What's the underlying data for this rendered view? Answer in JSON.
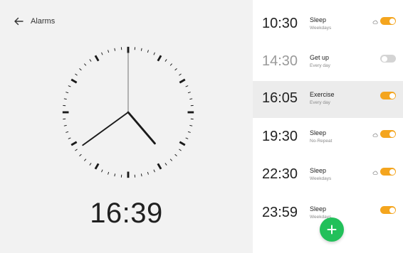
{
  "header": {
    "title": "Alarms",
    "back_icon": "arrow-left-icon"
  },
  "clock": {
    "hour": 16,
    "minute": 39,
    "digital_time": "16:39"
  },
  "alarms": [
    {
      "time": "10:30",
      "label": "Sleep",
      "repeat": "Weekdays",
      "enabled": true,
      "cloud_icon": true,
      "selected": false
    },
    {
      "time": "14:30",
      "label": "Get up",
      "repeat": "Every day",
      "enabled": false,
      "cloud_icon": false,
      "selected": false
    },
    {
      "time": "16:05",
      "label": "Exercise",
      "repeat": "Every day",
      "enabled": true,
      "cloud_icon": false,
      "selected": true
    },
    {
      "time": "19:30",
      "label": "Sleep",
      "repeat": "No-Repeat",
      "enabled": true,
      "cloud_icon": true,
      "selected": false
    },
    {
      "time": "22:30",
      "label": "Sleep",
      "repeat": "Weekdays",
      "enabled": true,
      "cloud_icon": true,
      "selected": false
    },
    {
      "time": "23:59",
      "label": "Sleep",
      "repeat": "Weekdays",
      "enabled": true,
      "cloud_icon": false,
      "selected": false
    }
  ],
  "fab": {
    "icon": "plus-icon"
  },
  "colors": {
    "accent": "#f4a51e",
    "fab": "#22c05a",
    "toggle_off": "#d4d4d4"
  }
}
